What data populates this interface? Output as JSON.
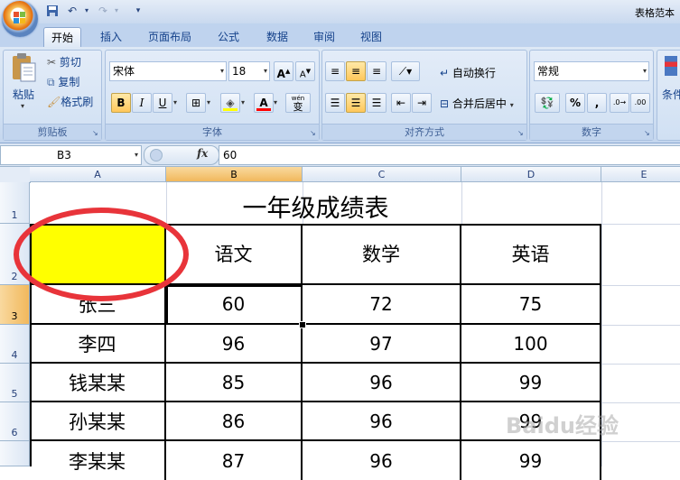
{
  "window": {
    "title": "表格范本"
  },
  "tabs": [
    "开始",
    "插入",
    "页面布局",
    "公式",
    "数据",
    "审阅",
    "视图"
  ],
  "clipboard": {
    "paste": "粘贴",
    "cut": "剪切",
    "copy": "复制",
    "format_painter": "格式刷",
    "label": "剪贴板"
  },
  "font": {
    "name": "宋体",
    "size": "18",
    "grow": "A",
    "shrink": "A",
    "bold": "B",
    "italic": "I",
    "underline": "U",
    "font_color": "A",
    "wen": "wén",
    "wen_char": "变",
    "label": "字体"
  },
  "alignment": {
    "wrap": "自动换行",
    "merge": "合并后居中",
    "label": "对齐方式"
  },
  "number": {
    "format": "常规",
    "percent": "%",
    "comma": ",",
    "label": "数字"
  },
  "styles": {
    "label": "条件"
  },
  "formula_bar": {
    "name_box": "B3",
    "fx": "fx",
    "value": "60"
  },
  "columns": [
    "A",
    "B",
    "C",
    "D",
    "E"
  ],
  "rows": [
    "1",
    "2",
    "3",
    "4",
    "5",
    "6"
  ],
  "sheet": {
    "title": "一年级成绩表",
    "headers": [
      "",
      "语文",
      "数学",
      "英语"
    ],
    "records": [
      {
        "name": "张三",
        "scores": [
          "60",
          "72",
          "75"
        ]
      },
      {
        "name": "李四",
        "scores": [
          "96",
          "97",
          "100"
        ]
      },
      {
        "name": "钱某某",
        "scores": [
          "85",
          "96",
          "99"
        ]
      },
      {
        "name": "孙某某",
        "scores": [
          "86",
          "96",
          "99"
        ]
      },
      {
        "name": "李某某",
        "scores": [
          "87",
          "96",
          "99"
        ]
      }
    ]
  },
  "colors": {
    "highlight": "#FFFF00",
    "annotation": "#E8343A",
    "selected_header": "#F1B85C"
  },
  "watermark": "Baidu经验"
}
